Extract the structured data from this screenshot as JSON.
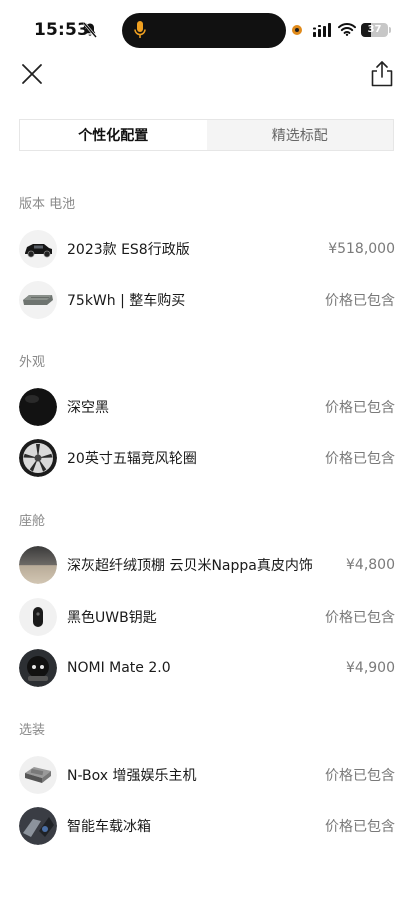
{
  "status_bar": {
    "time": "15:53",
    "battery": "37",
    "battery_level": 0.37
  },
  "nav": {
    "close_icon": "close-icon",
    "share_icon": "share-icon"
  },
  "tabs": [
    {
      "label": "个性化配置",
      "active": true
    },
    {
      "label": "精选标配",
      "active": false
    }
  ],
  "sections": [
    {
      "title": "版本 电池",
      "items": [
        {
          "label": "2023款 ES8行政版",
          "price": "¥518,000",
          "thumb": "car-thumbnail"
        },
        {
          "label": "75kWh | 整车购买",
          "price": "价格已包含",
          "thumb": "battery-thumbnail"
        }
      ]
    },
    {
      "title": "外观",
      "items": [
        {
          "label": "深空黑",
          "price": "价格已包含",
          "thumb": "color-swatch-black"
        },
        {
          "label": "20英寸五辐竞风轮圈",
          "price": "价格已包含",
          "thumb": "wheel-thumbnail"
        }
      ]
    },
    {
      "title": "座舱",
      "items": [
        {
          "label": "深灰超纤绒顶棚 云贝米Nappa真皮内饰",
          "price": "¥4,800",
          "thumb": "interior-thumbnail"
        },
        {
          "label": "黑色UWB钥匙",
          "price": "价格已包含",
          "thumb": "key-fob-thumbnail"
        },
        {
          "label": "NOMI Mate 2.0",
          "price": "¥4,900",
          "thumb": "nomi-thumbnail"
        }
      ]
    },
    {
      "title": "选装",
      "items": [
        {
          "label": "N-Box 增强娱乐主机",
          "price": "价格已包含",
          "thumb": "nbox-thumbnail"
        },
        {
          "label": "智能车载冰箱",
          "price": "价格已包含",
          "thumb": "fridge-thumbnail"
        }
      ]
    }
  ]
}
